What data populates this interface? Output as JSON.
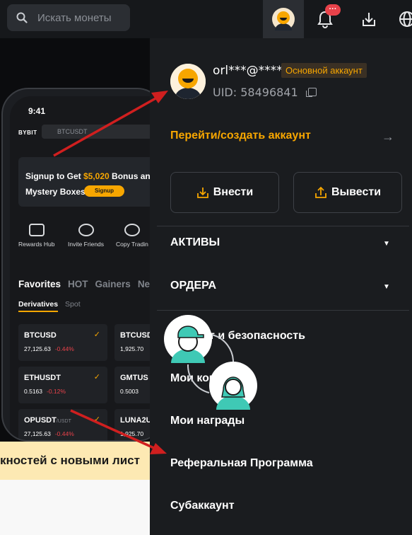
{
  "search": {
    "placeholder": "Искать монеты"
  },
  "topbar": {
    "notification_badge": "···"
  },
  "phone": {
    "time": "9:41",
    "logo": "BYBIT",
    "search_text": "BTCUSDT",
    "banner_line1_pre": "Signup to Get ",
    "banner_amount": "$5,020",
    "banner_line1_post": " Bonus an",
    "banner_line2": "Mystery Boxes",
    "signup_label": "Signup",
    "quick_actions": [
      "Rewards Hub",
      "Invite Friends",
      "Copy Tradin"
    ],
    "tabs": [
      "Favorites",
      "HOT",
      "Gainers",
      "Ne"
    ],
    "subtabs": [
      "Derivatives",
      "Spot"
    ],
    "cards": [
      {
        "symbol": "BTCUSD",
        "suffix": "",
        "price": "27,125.63",
        "change": "-0.44%"
      },
      {
        "symbol": "BTCUSD",
        "suffix": "",
        "price": "1,925.70",
        "change": ""
      },
      {
        "symbol": "ETHUSDT",
        "suffix": "",
        "price": "0.5163",
        "change": "-0.12%"
      },
      {
        "symbol": "GMTUS",
        "suffix": "",
        "price": "0.5003",
        "change": ""
      },
      {
        "symbol": "OPUSDT",
        "suffix": "/USDT",
        "price": "27,125.63",
        "change": "-0.44%"
      },
      {
        "symbol": "LUNA2U",
        "suffix": "",
        "price": "1,925.70",
        "change": ""
      }
    ]
  },
  "left_banner": {
    "text": "кностей с новыми лист"
  },
  "panel": {
    "email": "orl***@****",
    "account_tag": "Основной аккаунт",
    "uid": "UID: 58496841",
    "switch_account": "Перейти/создать аккаунт",
    "deposit": "Внести",
    "withdraw": "Вывести",
    "sections": [
      "АКТИВЫ",
      "ОРДЕРА"
    ],
    "items": [
      "Аккаунт и безопасность",
      "Мои комиссии",
      "Мои награды",
      "Реферальная Программа",
      "Субаккаунт"
    ]
  },
  "colors": {
    "accent": "#f7a600",
    "arrow": "#d01f1f",
    "panel_bg": "#1a1c1f",
    "teal": "#3fc9b5"
  }
}
